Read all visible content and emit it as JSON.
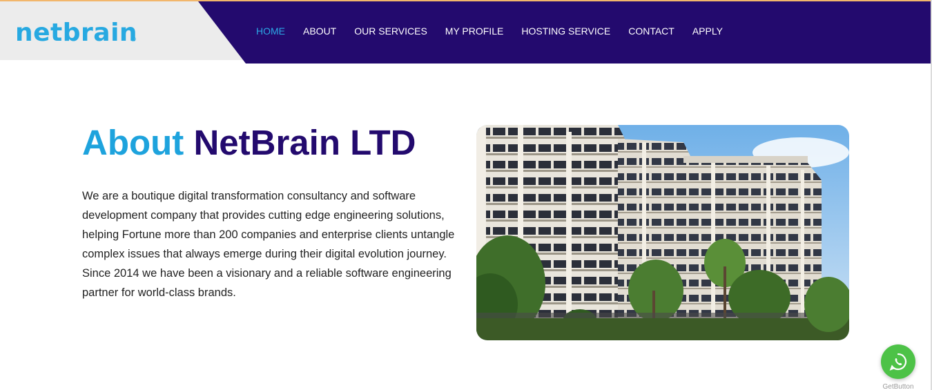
{
  "brand": {
    "logo_text": "netbrain",
    "logo_mark": "©",
    "accent_color": "#27a9e1",
    "navy_color": "#230a6e"
  },
  "nav": {
    "items": [
      {
        "label": "HOME",
        "active": true
      },
      {
        "label": "ABOUT",
        "active": false
      },
      {
        "label": "OUR SERVICES",
        "active": false
      },
      {
        "label": "MY PROFILE",
        "active": false
      },
      {
        "label": "HOSTING SERVICE",
        "active": false
      },
      {
        "label": "CONTACT",
        "active": false
      },
      {
        "label": "APPLY",
        "active": false
      }
    ]
  },
  "about": {
    "title_accent": "About",
    "title_main": "NetBrain LTD",
    "body": "We are a boutique digital transformation consultancy and software development company that provides cutting edge engineering solutions, helping Fortune more than 200 companies and enterprise clients untangle complex issues that always emerge during their digital evolution journey. Since 2014 we have been a visionary and a reliable software engineering partner for world-class brands."
  },
  "photo": {
    "icon": "office-building-photo"
  },
  "whatsapp": {
    "icon": "whatsapp-icon",
    "caption": "GetButton",
    "color": "#4dc247"
  }
}
